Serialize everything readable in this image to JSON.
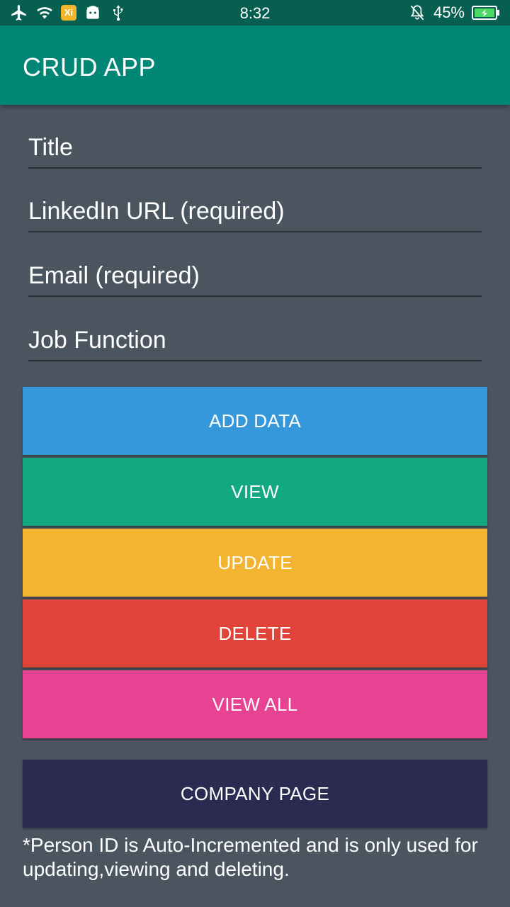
{
  "status_bar": {
    "time": "8:32",
    "battery": "45%",
    "xi_badge": "Xi",
    "icons": [
      "airplane-icon",
      "wifi-icon",
      "xi-app-icon",
      "android-icon",
      "usb-icon",
      "silent-bell-icon",
      "battery-charging-icon"
    ]
  },
  "app_bar": {
    "title": "CRUD APP"
  },
  "form": {
    "title_placeholder": "Title",
    "linkedin_placeholder": "LinkedIn URL (required)",
    "email_placeholder": "Email (required)",
    "job_placeholder": "Job Function"
  },
  "buttons": {
    "add": "ADD DATA",
    "view": "VIEW",
    "update": "UPDATE",
    "delete": "DELETE",
    "view_all": "VIEW ALL",
    "company": "COMPANY PAGE"
  },
  "colors": {
    "status_bar": "#075f52",
    "app_bar": "#018574",
    "background": "#4a5560",
    "add": "#3598db",
    "view": "#12a882",
    "update": "#f3b431",
    "delete": "#e24339",
    "view_all": "#e84393",
    "company": "#2b2b52"
  },
  "note": "*Person ID is Auto-Incremented and is only used for updating,viewing and deleting."
}
